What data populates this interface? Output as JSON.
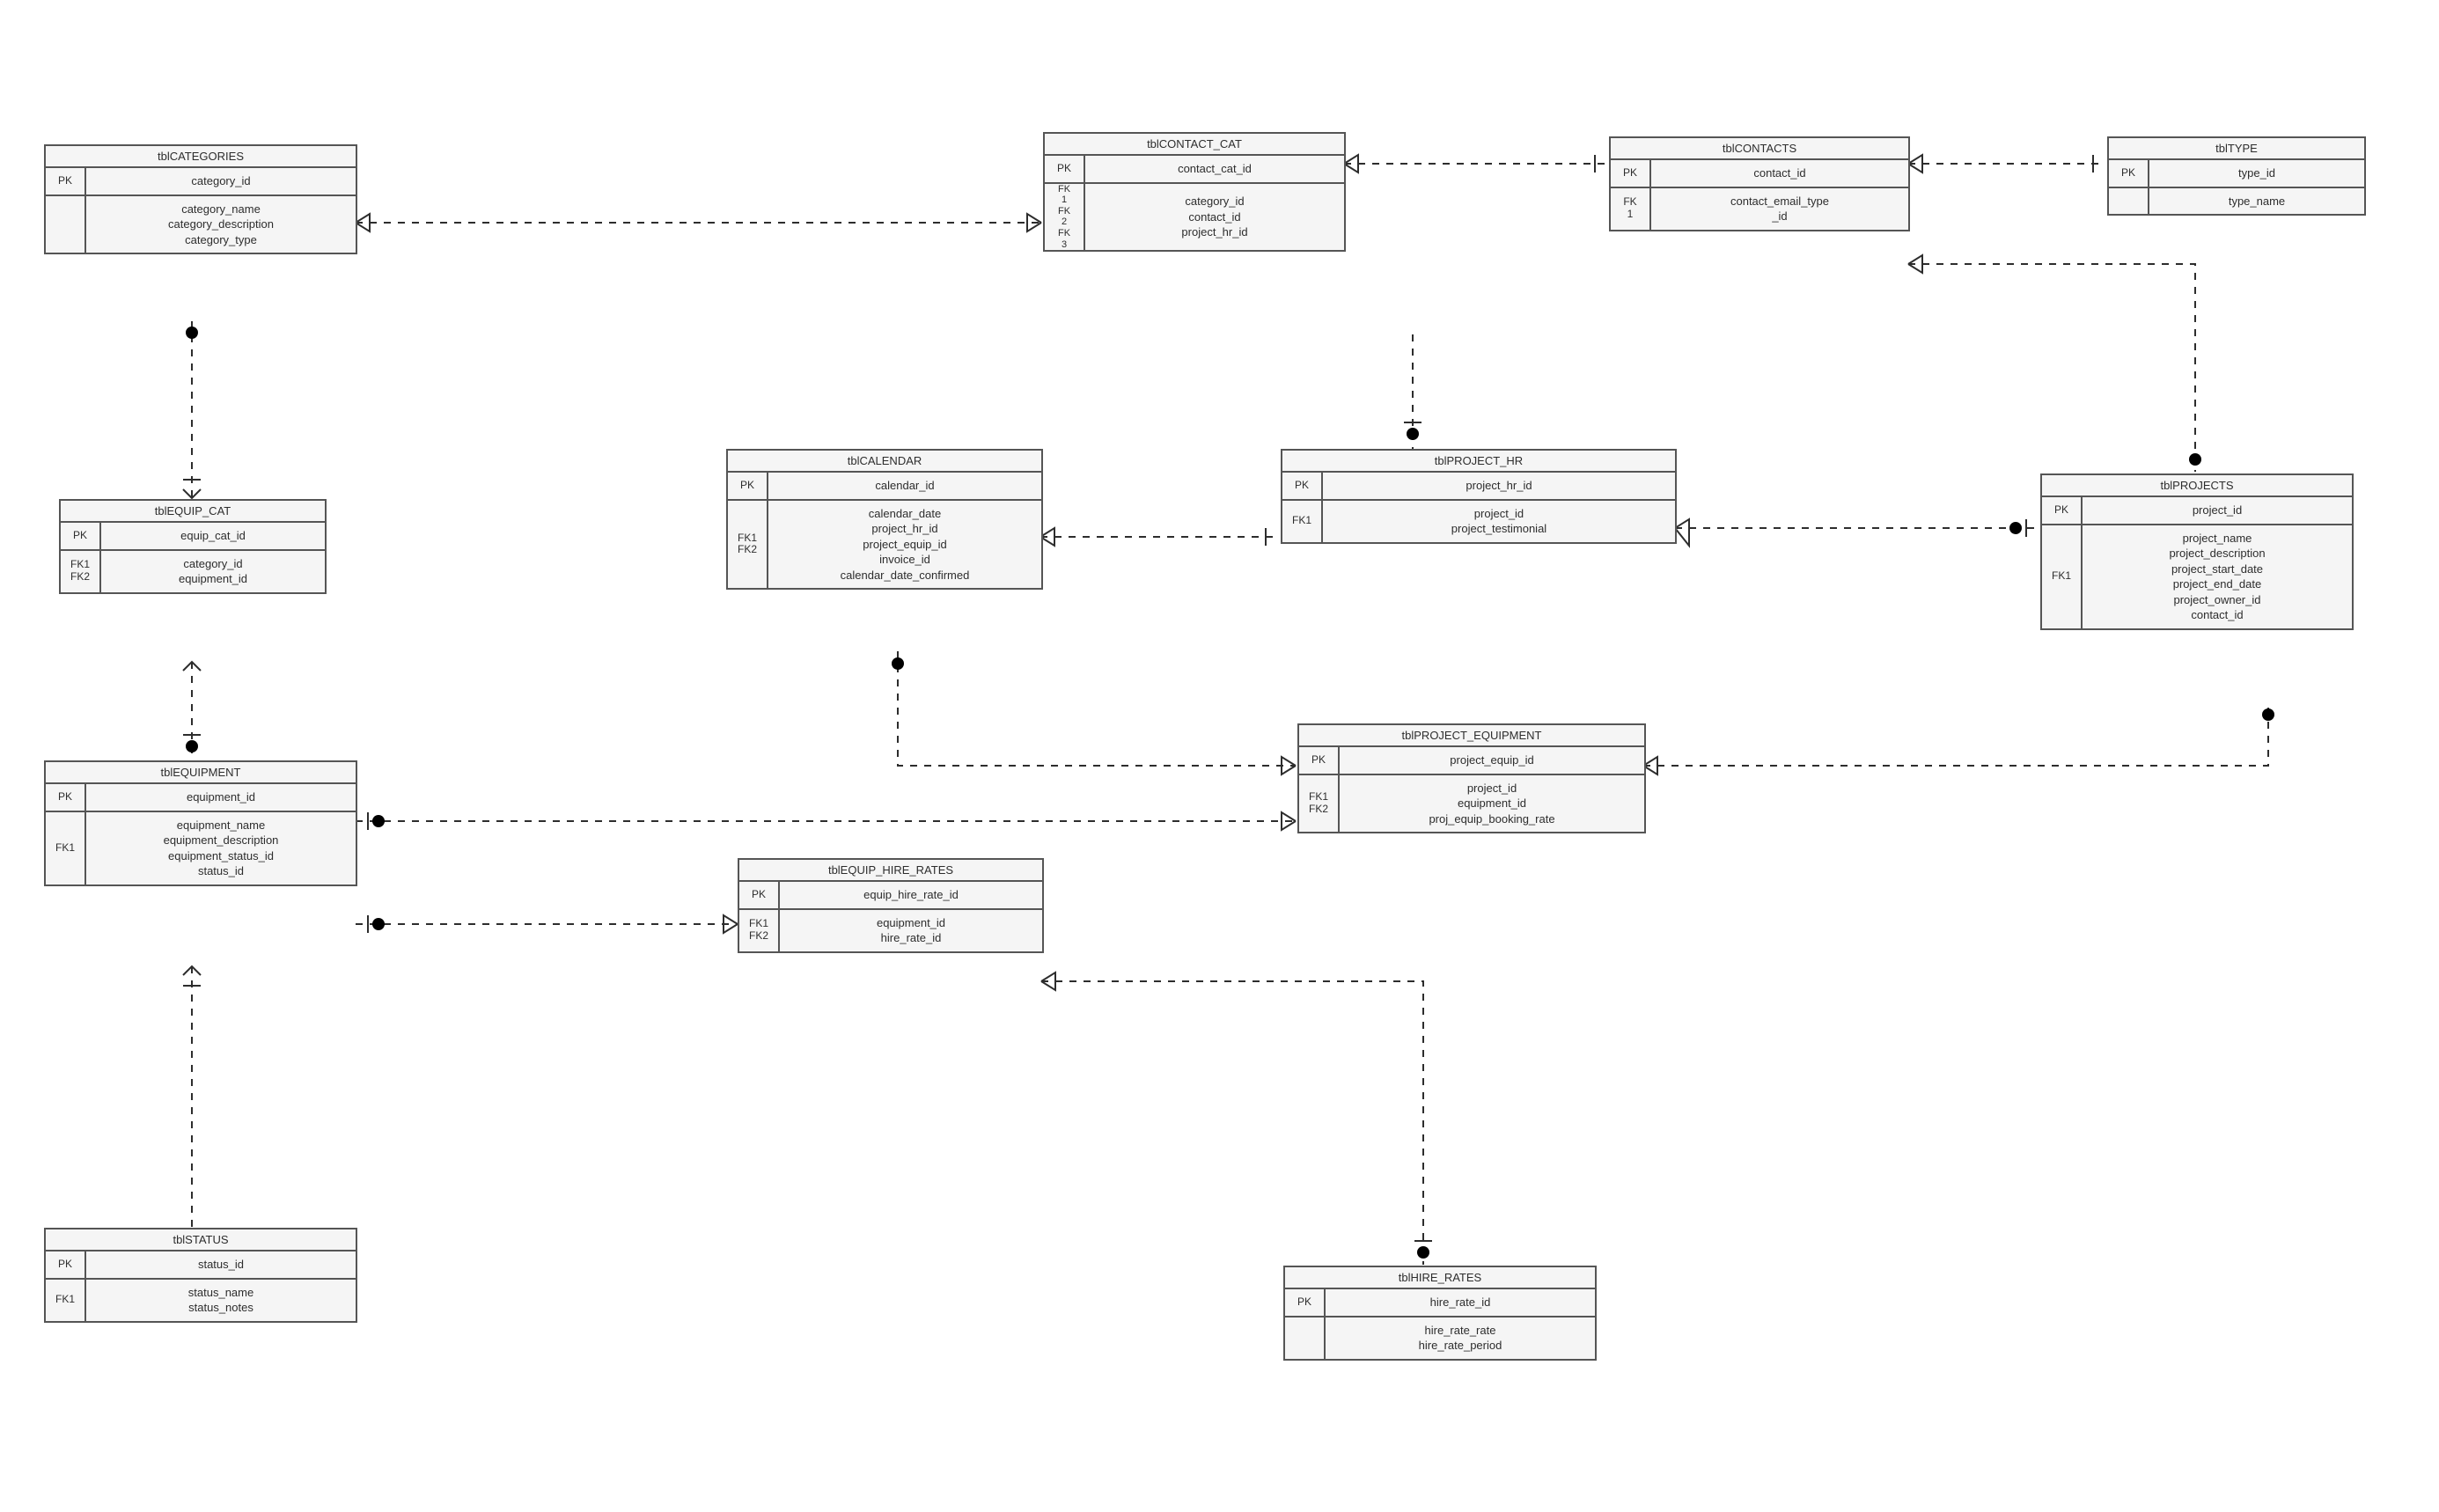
{
  "entities": {
    "categories": {
      "title": "tblCATEGORIES",
      "pk_label": "PK",
      "pk_field": "category_id",
      "body_keys": "",
      "body_fields": [
        "category_name",
        "category_description",
        "category_type"
      ]
    },
    "equip_cat": {
      "title": "tblEQUIP_CAT",
      "pk_label": "PK",
      "pk_field": "equip_cat_id",
      "body_keys": "FK1\nFK2",
      "body_fields": [
        "category_id",
        "equipment_id"
      ]
    },
    "equipment": {
      "title": "tblEQUIPMENT",
      "pk_label": "PK",
      "pk_field": "equipment_id",
      "body_keys": "FK1",
      "body_fields": [
        "equipment_name",
        "equipment_description",
        "equipment_status_id",
        "status_id"
      ]
    },
    "status": {
      "title": "tblSTATUS",
      "pk_label": "PK",
      "pk_field": "status_id",
      "body_keys": "FK1",
      "body_fields": [
        "status_name",
        "status_notes"
      ]
    },
    "contact_cat": {
      "title": "tblCONTACT_CAT",
      "pk_label": "PK",
      "pk_field": "contact_cat_id",
      "body_keys": "FK\n1\nFK\n2\nFK\n3",
      "body_fields": [
        "category_id",
        "contact_id",
        "project_hr_id"
      ]
    },
    "contacts": {
      "title": "tblCONTACTS",
      "pk_label": "PK",
      "pk_field": "contact_id",
      "body_keys": "FK\n1",
      "body_fields": [
        "contact_email_type\n_id"
      ]
    },
    "type": {
      "title": "tblTYPE",
      "pk_label": "PK",
      "pk_field": "type_id",
      "body_keys": "",
      "body_fields": [
        "type_name"
      ]
    },
    "calendar": {
      "title": "tblCALENDAR",
      "pk_label": "PK",
      "pk_field": "calendar_id",
      "body_keys": "FK1\nFK2",
      "body_fields": [
        "calendar_date",
        "project_hr_id",
        "project_equip_id",
        "invoice_id",
        "calendar_date_confirmed"
      ]
    },
    "project_hr": {
      "title": "tblPROJECT_HR",
      "pk_label": "PK",
      "pk_field": "project_hr_id",
      "body_keys": "FK1",
      "body_fields": [
        "project_id",
        "project_testimonial"
      ]
    },
    "projects": {
      "title": "tblPROJECTS",
      "pk_label": "PK",
      "pk_field": "project_id",
      "body_keys": "FK1",
      "body_fields": [
        "project_name",
        "project_description",
        "project_start_date",
        "project_end_date",
        "project_owner_id",
        "contact_id"
      ]
    },
    "project_equipment": {
      "title": "tblPROJECT_EQUIPMENT",
      "pk_label": "PK",
      "pk_field": "project_equip_id",
      "body_keys": "FK1\nFK2",
      "body_fields": [
        "project_id",
        "equipment_id",
        "proj_equip_booking_rate"
      ]
    },
    "equip_hire_rates": {
      "title": "tblEQUIP_HIRE_RATES",
      "pk_label": "PK",
      "pk_field": "equip_hire_rate_id",
      "body_keys": "FK1\nFK2",
      "body_fields": [
        "equipment_id",
        "hire_rate_id"
      ]
    },
    "hire_rates": {
      "title": "tblHIRE_RATES",
      "pk_label": "PK",
      "pk_field": "hire_rate_id",
      "body_keys": "",
      "body_fields": [
        "hire_rate_rate",
        "hire_rate_period"
      ]
    }
  }
}
